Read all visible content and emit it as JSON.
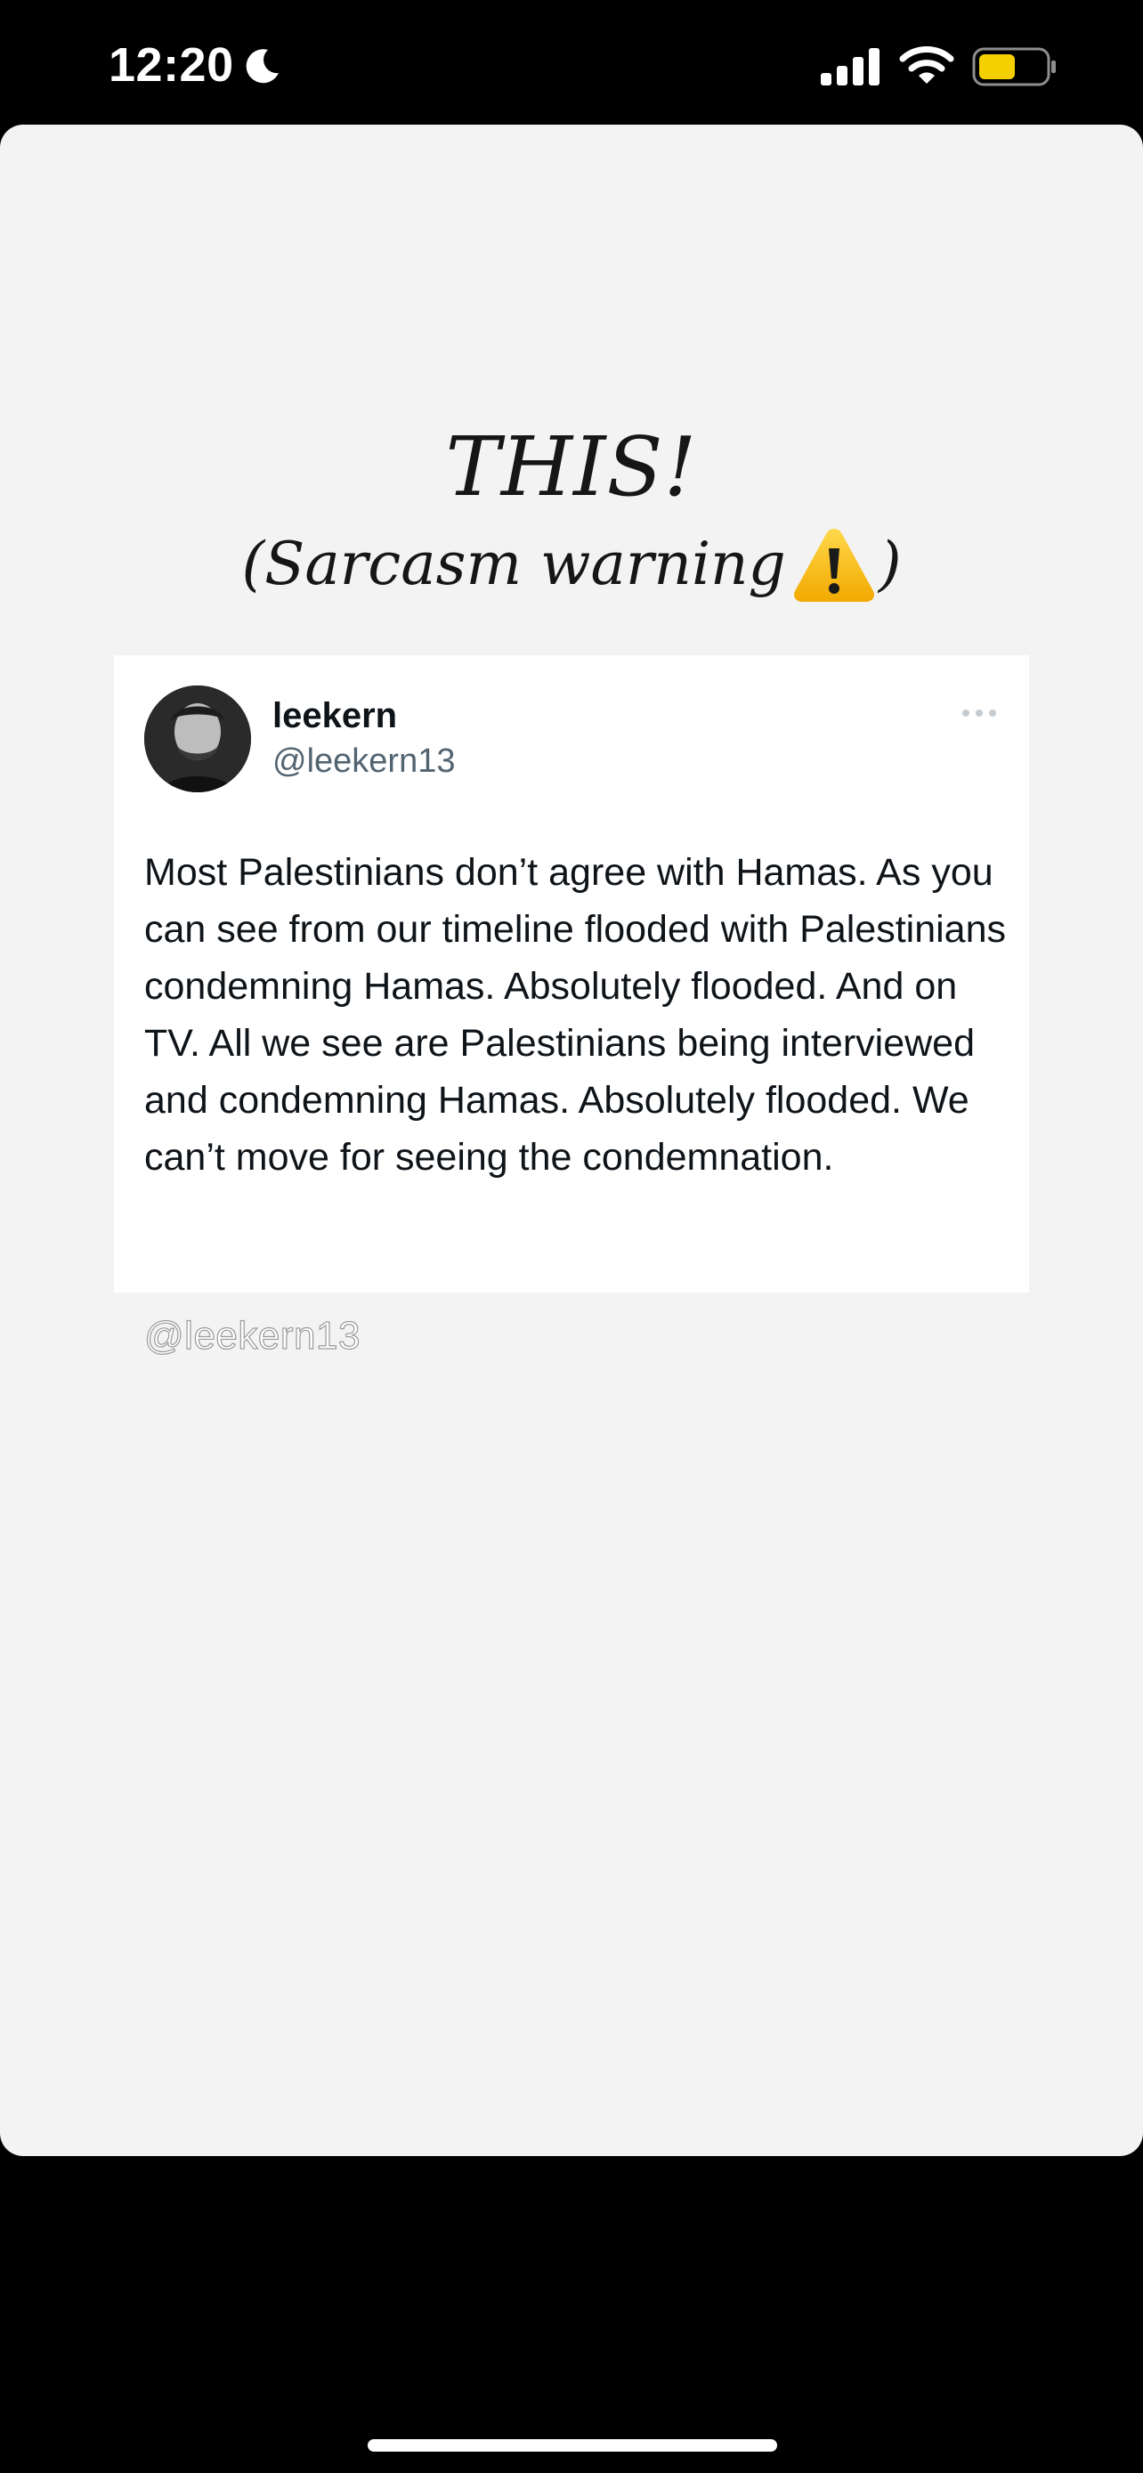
{
  "status_bar": {
    "time": "12:20",
    "icons": [
      "moon-icon",
      "signal-icon",
      "wifi-icon",
      "battery-icon"
    ],
    "battery_color": "#f5d000"
  },
  "story": {
    "background": "#f3f3f3",
    "headline": {
      "title": "THIS!",
      "subtitle_open": "(Sarcasm warning",
      "subtitle_close": ")",
      "icon": "warning-icon"
    },
    "tweet": {
      "display_name": "leekern",
      "handle": "@leekern13",
      "more_icon": "more-dots-icon",
      "text": "Most Palestinians don’t agree with Hamas. As you can see from our timeline flooded with Palestinians condemning Hamas. Absolutely flooded. And on TV. All we see are Palestinians being interviewed and condemning Hamas. Absolutely flooded. We can’t move for seeing the condemnation."
    },
    "watermark": "@leekern13"
  }
}
